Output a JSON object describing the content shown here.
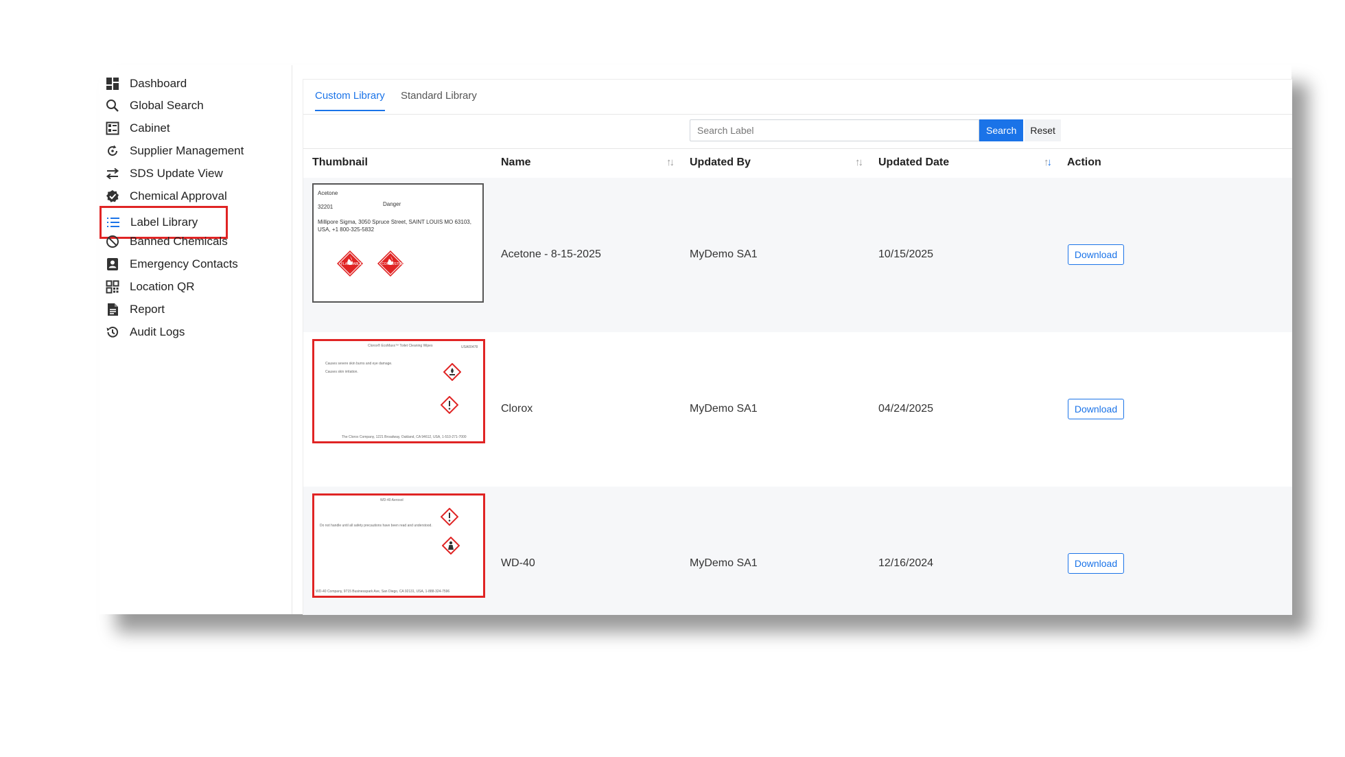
{
  "sidebar": {
    "items": [
      {
        "label": "Dashboard",
        "icon": "dashboard-icon"
      },
      {
        "label": "Global Search",
        "icon": "search-icon"
      },
      {
        "label": "Cabinet",
        "icon": "cabinet-icon"
      },
      {
        "label": "Supplier Management",
        "icon": "refresh-icon"
      },
      {
        "label": "SDS Update View",
        "icon": "swap-arrows-icon"
      },
      {
        "label": "Chemical Approval",
        "icon": "badge-check-icon"
      },
      {
        "label": "Label Library",
        "icon": "list-icon"
      },
      {
        "label": "Banned Chemicals",
        "icon": "ban-icon"
      },
      {
        "label": "Emergency Contacts",
        "icon": "contact-card-icon"
      },
      {
        "label": "Location QR",
        "icon": "qr-code-icon"
      },
      {
        "label": "Report",
        "icon": "report-icon"
      },
      {
        "label": "Audit Logs",
        "icon": "history-icon"
      }
    ],
    "selected": "Label Library"
  },
  "tabs": [
    {
      "label": "Custom Library",
      "active": true
    },
    {
      "label": "Standard Library",
      "active": false
    }
  ],
  "search": {
    "placeholder": "Search Label",
    "value": "",
    "search_label": "Search",
    "reset_label": "Reset"
  },
  "table": {
    "columns": [
      "Thumbnail",
      "Name",
      "Updated By",
      "Updated Date",
      "Action"
    ],
    "rows": [
      {
        "name": "Acetone - 8-15-2025",
        "updated_by": "MyDemo SA1",
        "updated_date": "10/15/2025",
        "action": "Download",
        "thumb": {
          "product": "Acetone",
          "code": "32201",
          "signal": "Danger",
          "supplier_line1": "Millipore Sigma, 3050 Spruce Street, SAINT LOUIS MO 63103,",
          "supplier_line2": "USA, +1 800-325-5832",
          "pictogram_1": "FLAMMABLE LIQUID",
          "pictogram_2": "COMBUSTIBLE"
        }
      },
      {
        "name": "Clorox",
        "updated_by": "MyDemo SA1",
        "updated_date": "04/24/2025",
        "action": "Download",
        "thumb": {
          "title": "Clorox® EcoMaxx™ Toilet Cleaning Wipes",
          "code": "USA00478",
          "line1": "Causes severe skin burns and eye damage.",
          "line2": "Causes skin irritation.",
          "footer": "The Clorox Company, 1221 Broadway, Oakland, CA 94612, USA, 1-510-271-7000"
        }
      },
      {
        "name": "WD-40",
        "updated_by": "MyDemo SA1",
        "updated_date": "12/16/2024",
        "action": "Download",
        "thumb": {
          "title": "WD-40 Aerosol",
          "line1": "Do not handle until all safety precautions have been read and understood.",
          "footer": "WD-40 Company, 9715 Businesspark Ave, San Diego, CA 92131, USA, 1-888-324-7596"
        }
      }
    ]
  },
  "colors": {
    "accent": "#1a73e8",
    "highlight": "#e02424",
    "hazard": "#e02424"
  }
}
